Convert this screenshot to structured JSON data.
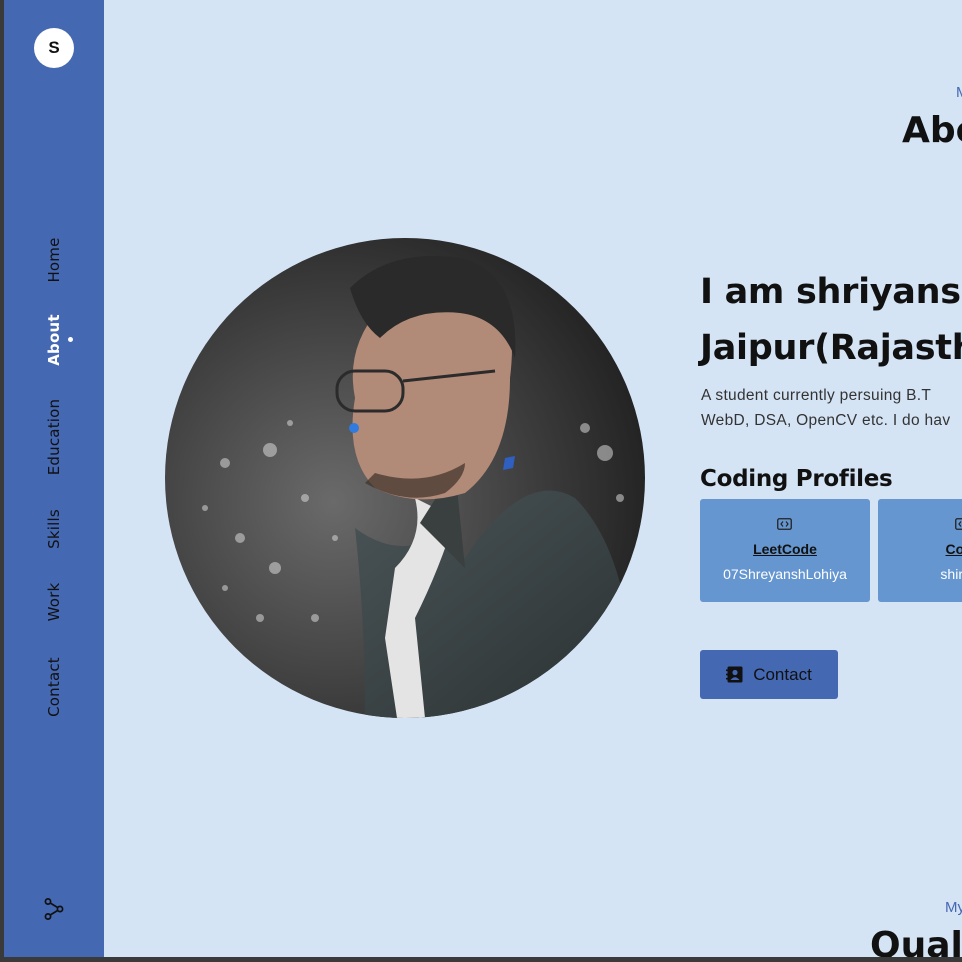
{
  "sidebar": {
    "logo_letter": "S",
    "nav": [
      {
        "label": "Home"
      },
      {
        "label": "About"
      },
      {
        "label": "Education"
      },
      {
        "label": "Skills"
      },
      {
        "label": "Work"
      },
      {
        "label": "Contact"
      }
    ],
    "active": "About",
    "share_icon": "share-icon"
  },
  "about": {
    "subtitle": "M",
    "title": "Abo",
    "intro_line1": "I am shriyansh",
    "intro_line2": "Jaipur(Rajasth",
    "desc_line1": "A  student  currently  persuing  B.T",
    "desc_line2": "WebD, DSA, OpenCV etc. I do hav",
    "profiles_heading": "Coding Profiles",
    "profiles": [
      {
        "name": "LeetCode",
        "user": "07ShreyanshLohiya",
        "icon": "code-icon"
      },
      {
        "name": "Code",
        "user": "shiryan",
        "icon": "code-icon"
      }
    ],
    "contact_label": "Contact",
    "contact_icon": "contact-book-icon"
  },
  "qualification": {
    "subtitle": "My",
    "title": "Quali"
  },
  "colors": {
    "sidebar": "#4568b2",
    "background": "#d4e4f5",
    "card": "#6596cf",
    "accent": "#4568b2"
  }
}
